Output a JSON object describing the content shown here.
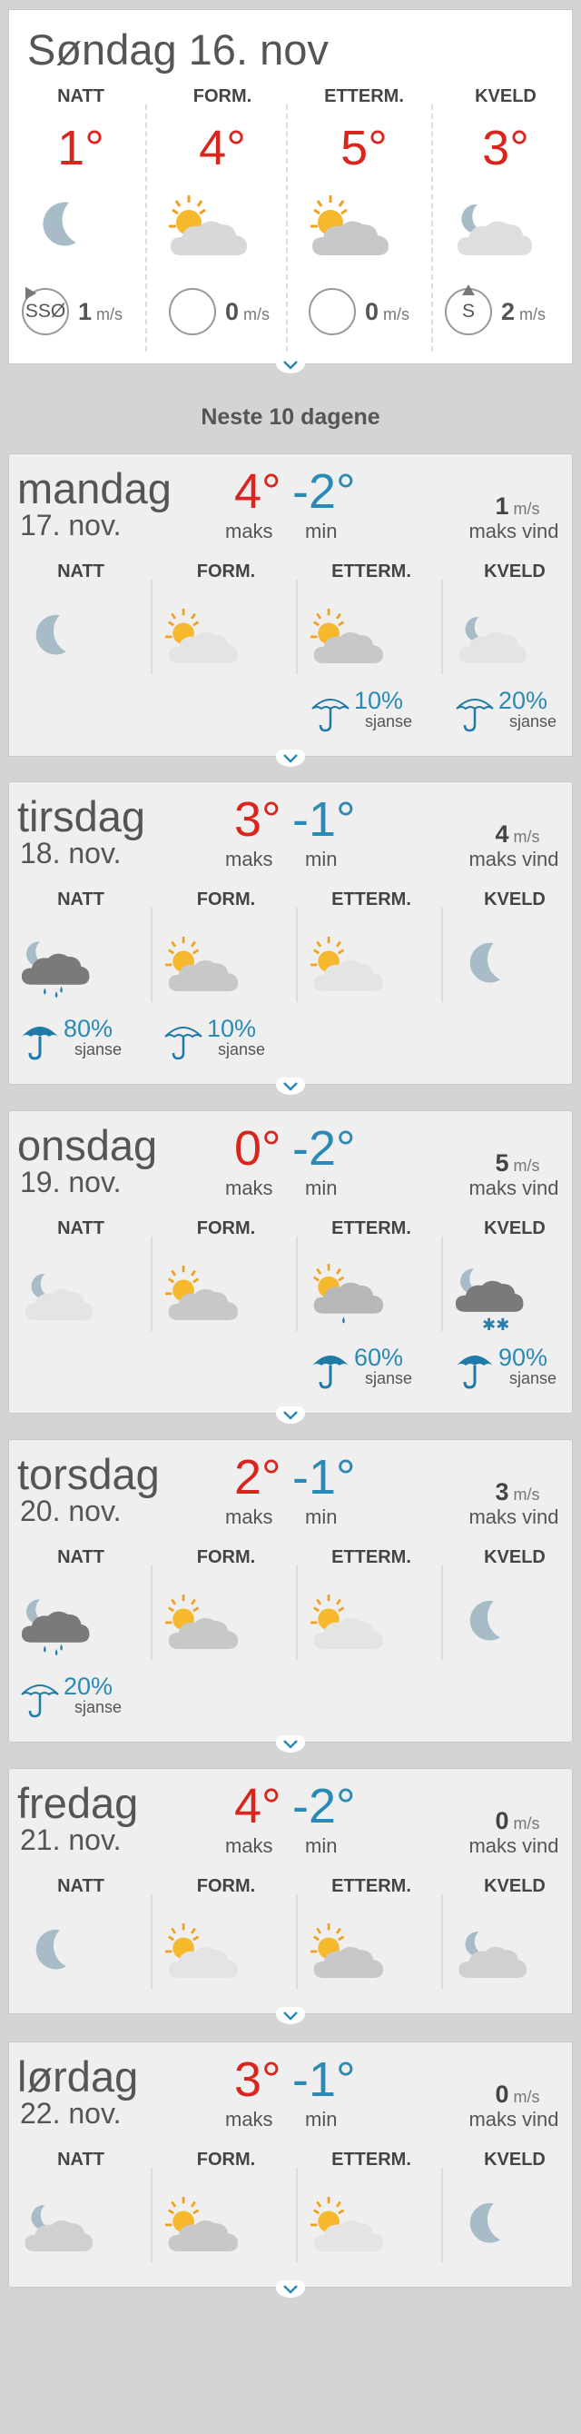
{
  "today": {
    "title": "Søndag 16. nov",
    "periods": [
      {
        "label": "NATT",
        "temp": "1°",
        "icon": "moon-icon",
        "wind_dir": "SSØ",
        "wind_speed": "1",
        "wind_unit": "m/s"
      },
      {
        "label": "FORM.",
        "temp": "4°",
        "icon": "partly-cloudy-icon",
        "wind_dir": "",
        "wind_speed": "0",
        "wind_unit": "m/s"
      },
      {
        "label": "ETTERM.",
        "temp": "5°",
        "icon": "partly-cloudy-icon",
        "wind_dir": "",
        "wind_speed": "0",
        "wind_unit": "m/s"
      },
      {
        "label": "KVELD",
        "temp": "3°",
        "icon": "moon-cloud-icon",
        "wind_dir": "S",
        "wind_speed": "2",
        "wind_unit": "m/s"
      }
    ]
  },
  "section_title": "Neste 10 dagene",
  "labels": {
    "maks": "maks",
    "min": "min",
    "maks_vind": "maks vind",
    "wind_unit": "m/s",
    "sjanse": "sjanse"
  },
  "days": [
    {
      "name": "mandag",
      "date": "17. nov.",
      "max": "4°",
      "min": "-2°",
      "wind": "1",
      "periods": [
        {
          "label": "NATT",
          "icon": "moon-icon"
        },
        {
          "label": "FORM.",
          "icon": "sun-light-cloud-icon"
        },
        {
          "label": "ETTERM.",
          "icon": "partly-cloudy-icon"
        },
        {
          "label": "KVELD",
          "icon": "moon-light-cloud-icon"
        }
      ],
      "precip": [
        {
          "col": 2,
          "value": "10%"
        },
        {
          "col": 3,
          "value": "20%"
        }
      ]
    },
    {
      "name": "tirsdag",
      "date": "18. nov.",
      "max": "3°",
      "min": "-1°",
      "wind": "4",
      "periods": [
        {
          "label": "NATT",
          "icon": "moon-rain-cloud-icon"
        },
        {
          "label": "FORM.",
          "icon": "partly-cloudy-icon"
        },
        {
          "label": "ETTERM.",
          "icon": "sun-light-cloud-icon"
        },
        {
          "label": "KVELD",
          "icon": "moon-icon"
        }
      ],
      "precip": [
        {
          "col": 0,
          "value": "80%"
        },
        {
          "col": 1,
          "value": "10%"
        }
      ]
    },
    {
      "name": "onsdag",
      "date": "19. nov.",
      "max": "0°",
      "min": "-2°",
      "wind": "5",
      "periods": [
        {
          "label": "NATT",
          "icon": "moon-light-cloud-icon"
        },
        {
          "label": "FORM.",
          "icon": "partly-cloudy-icon"
        },
        {
          "label": "ETTERM.",
          "icon": "sun-rain-cloud-icon"
        },
        {
          "label": "KVELD",
          "icon": "moon-snow-cloud-icon"
        }
      ],
      "precip": [
        {
          "col": 2,
          "value": "60%"
        },
        {
          "col": 3,
          "value": "90%"
        }
      ]
    },
    {
      "name": "torsdag",
      "date": "20. nov.",
      "max": "2°",
      "min": "-1°",
      "wind": "3",
      "periods": [
        {
          "label": "NATT",
          "icon": "moon-rain-cloud-icon"
        },
        {
          "label": "FORM.",
          "icon": "partly-cloudy-icon"
        },
        {
          "label": "ETTERM.",
          "icon": "sun-light-cloud-icon"
        },
        {
          "label": "KVELD",
          "icon": "moon-icon"
        }
      ],
      "precip": [
        {
          "col": 0,
          "value": "20%"
        }
      ]
    },
    {
      "name": "fredag",
      "date": "21. nov.",
      "max": "4°",
      "min": "-2°",
      "wind": "0",
      "periods": [
        {
          "label": "NATT",
          "icon": "moon-icon"
        },
        {
          "label": "FORM.",
          "icon": "sun-light-cloud-icon"
        },
        {
          "label": "ETTERM.",
          "icon": "partly-cloudy-icon"
        },
        {
          "label": "KVELD",
          "icon": "moon-cloud-icon"
        }
      ],
      "precip": []
    },
    {
      "name": "lørdag",
      "date": "22. nov.",
      "max": "3°",
      "min": "-1°",
      "wind": "0",
      "periods": [
        {
          "label": "NATT",
          "icon": "moon-cloud-icon"
        },
        {
          "label": "FORM.",
          "icon": "partly-cloudy-icon"
        },
        {
          "label": "ETTERM.",
          "icon": "sun-light-cloud-icon"
        },
        {
          "label": "KVELD",
          "icon": "moon-icon"
        }
      ],
      "precip": []
    }
  ],
  "colors": {
    "max_temp": "#d9251d",
    "min_temp": "#2a8ab5",
    "precip": "#2a8ab5",
    "background": "#d4d4d4",
    "card": "#efefef"
  }
}
